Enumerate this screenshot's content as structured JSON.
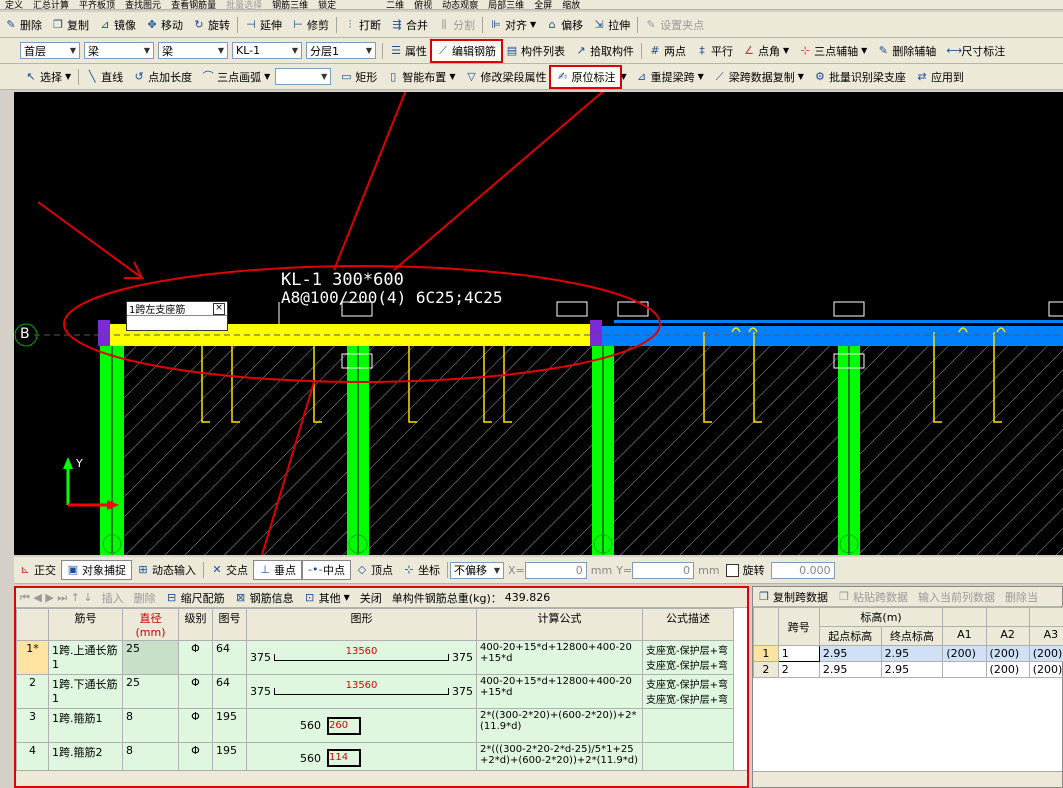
{
  "toolbar_top": [
    "删除",
    "复制",
    "镜像",
    "移动",
    "旋转",
    "延伸",
    "修剪",
    "打断",
    "合并",
    "分割",
    "对齐",
    "偏移",
    "拉伸",
    "设置夹点"
  ],
  "toolbar_top_partial": [
    "定义",
    "汇总计算",
    "平齐板顶",
    "查找图元",
    "查看钢筋量",
    "批量选择",
    "钢筋三维",
    "锁定",
    "二维",
    "俯视",
    "动态观察",
    "局部三维",
    "全屏",
    "缩放"
  ],
  "selectors": {
    "floor": "首层",
    "type1": "梁",
    "type2": "梁",
    "component": "KL-1",
    "layer": "分层1"
  },
  "toolbar_mid": [
    "属性",
    "编辑钢筋",
    "构件列表",
    "拾取构件",
    "两点",
    "平行",
    "点角",
    "三点辅轴",
    "删除辅轴",
    "尺寸标注"
  ],
  "toolbar_bottom": [
    "选择",
    "直线",
    "点加长度",
    "三点画弧",
    "矩形",
    "智能布置",
    "修改梁段属性",
    "原位标注",
    "重提梁跨",
    "梁跨数据复制",
    "批量识别梁支座",
    "应用到"
  ],
  "canvas": {
    "beam_label_line1": "KL-1 300*600",
    "beam_label_line2": "A8@100/200(4) 6C25;4C25",
    "input_popup_title": "1跨左支座筋",
    "input_popup_close": "×",
    "axis_label": "B",
    "axis_y": "Y"
  },
  "snapbar": {
    "items": [
      "正交",
      "对象捕捉",
      "动态输入",
      "交点",
      "垂点",
      "中点",
      "顶点",
      "坐标"
    ],
    "offset_select": "不偏移",
    "x_label": "X=",
    "x_value": "0",
    "y_label": "Y=",
    "y_value": "0",
    "unit": "mm",
    "rotate_label": "旋转",
    "rotate_value": "0.000"
  },
  "rebar_toolbar": {
    "items": [
      "插入",
      "删除",
      "缩尺配筋",
      "钢筋信息",
      "其他",
      "关闭"
    ],
    "total_label": "单构件钢筋总重(kg)：",
    "total_value": "439.826"
  },
  "rebar_table": {
    "headers": [
      "筋号",
      "直径(mm)",
      "级别",
      "图号",
      "图形",
      "计算公式",
      "公式描述"
    ],
    "rows": [
      {
        "no": "1*",
        "name": "1跨.上通长筋1",
        "dia": "25",
        "grade": "Φ",
        "fig": "64",
        "left": "375",
        "mid": "13560",
        "right": "375",
        "formula": "400-20+15*d+12800+400-20+15*d",
        "desc": "支座宽-保护层+弯 支座宽-保护层+弯"
      },
      {
        "no": "2",
        "name": "1跨.下通长筋1",
        "dia": "25",
        "grade": "Φ",
        "fig": "64",
        "left": "375",
        "mid": "13560",
        "right": "375",
        "formula": "400-20+15*d+12800+400-20+15*d",
        "desc": "支座宽-保护层+弯 支座宽-保护层+弯"
      },
      {
        "no": "3",
        "name": "1跨.箍筋1",
        "dia": "8",
        "grade": "Φ",
        "fig": "195",
        "left": "560",
        "mid": "260",
        "right": "",
        "formula": "2*((300-2*20)+(600-2*20))+2*(11.9*d)",
        "desc": ""
      },
      {
        "no": "4",
        "name": "1跨.箍筋2",
        "dia": "8",
        "grade": "Φ",
        "fig": "195",
        "left": "560",
        "mid": "114",
        "right": "",
        "formula": "2*(((300-2*20-2*d-25)/5*1+25+2*d)+(600-2*20))+2*(11.9*d)",
        "desc": ""
      }
    ]
  },
  "span_toolbar": [
    "复制跨数据",
    "粘贴跨数据",
    "输入当前列数据",
    "删除当"
  ],
  "span_table": {
    "group_header": "标高(m)",
    "headers": [
      "跨号",
      "起点标高",
      "终点标高",
      "A1",
      "A2",
      "A3"
    ],
    "rows": [
      {
        "idx": "1",
        "span": "1",
        "start": "2.95",
        "end": "2.95",
        "a1": "(200)",
        "a2": "(200)",
        "a3": "(200)"
      },
      {
        "idx": "2",
        "span": "2",
        "start": "2.95",
        "end": "2.95",
        "a1": "",
        "a2": "(200)",
        "a3": "(200)"
      }
    ]
  },
  "colors": {
    "beam_yellow": "#ffff00",
    "column_green": "#00ff00",
    "beam_blue": "#0080ff",
    "annotation_red": "#e00000",
    "row_green": "#dff7df"
  }
}
